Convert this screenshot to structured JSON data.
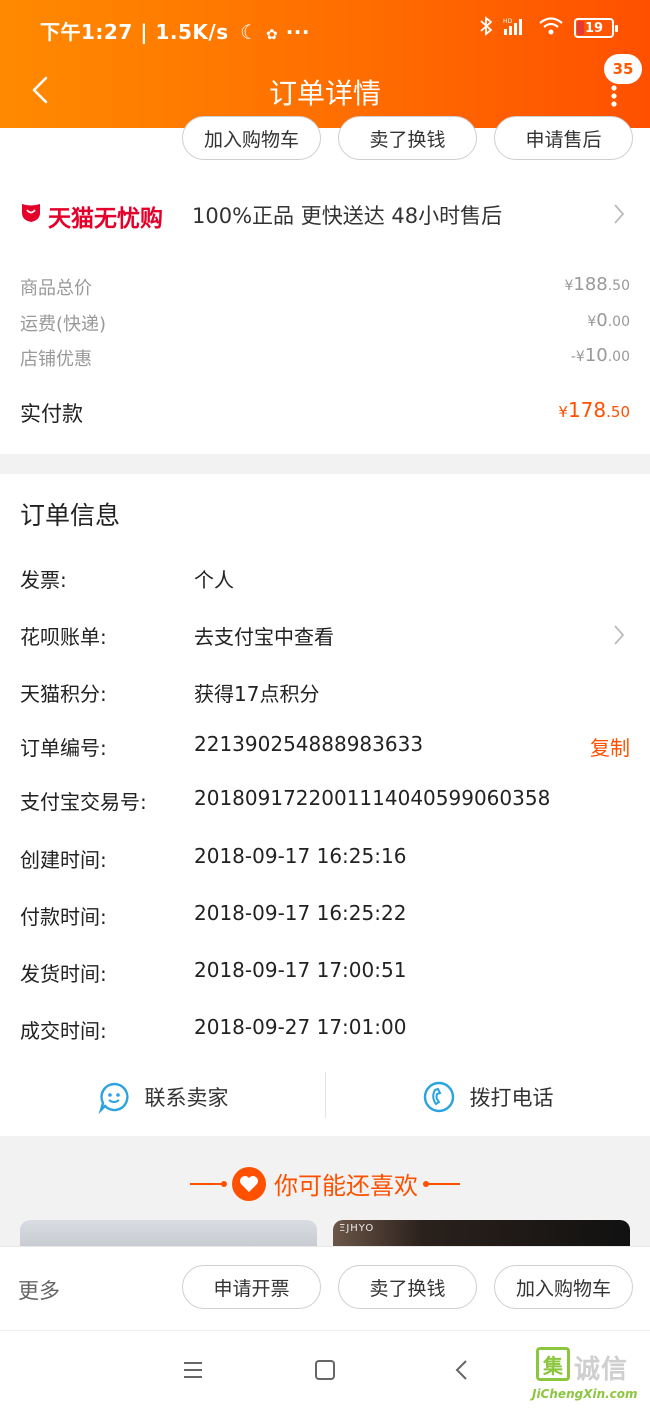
{
  "status_bar": {
    "time_speed": "下午1:27 | 1.5K/s",
    "battery": "19",
    "battery_fill": 0.19
  },
  "nav": {
    "title": "订单详情",
    "badge_count": "35"
  },
  "top_actions": {
    "add_cart": "加入购物车",
    "sell": "卖了换钱",
    "after_sale": "申请售后"
  },
  "tmall": {
    "brand": "天猫无忧购",
    "promise": "100%正品  更快送达  48小时售后"
  },
  "prices": {
    "goods_total": {
      "label": "商品总价",
      "symbol": "¥",
      "int": "188",
      "dec": ".50"
    },
    "shipping": {
      "label": "运费(快递)",
      "symbol": "¥",
      "int": "0",
      "dec": ".00"
    },
    "discount": {
      "label": "店铺优惠",
      "symbol": "-¥",
      "int": "10",
      "dec": ".00"
    },
    "paid": {
      "label": "实付款",
      "symbol": "¥",
      "int": "178",
      "dec": ".50"
    }
  },
  "order_info": {
    "title": "订单信息",
    "invoice": {
      "k": "发票:",
      "v": "个人"
    },
    "huabei": {
      "k": "花呗账单:",
      "v": "去支付宝中查看"
    },
    "points": {
      "k": "天猫积分:",
      "v": "获得17点积分"
    },
    "order_no": {
      "k": "订单编号:",
      "v": "221390254888983633",
      "copy": "复制"
    },
    "alipay_no": {
      "k": "支付宝交易号:",
      "v": "2018091722001114040599060358"
    },
    "created": {
      "k": "创建时间:",
      "v": "2018-09-17 16:25:16"
    },
    "paid_time": {
      "k": "付款时间:",
      "v": "2018-09-17 16:25:22"
    },
    "shipped": {
      "k": "发货时间:",
      "v": "2018-09-17 17:00:51"
    },
    "closed": {
      "k": "成交时间:",
      "v": "2018-09-27 17:01:00"
    }
  },
  "contact": {
    "seller": "联系卖家",
    "phone": "拨打电话"
  },
  "recommend": {
    "title": "你可能还喜欢",
    "thumb2_brand": "ΞJHYO"
  },
  "bottom_bar": {
    "more": "更多",
    "invoice": "申请开票",
    "sell": "卖了换钱",
    "add_cart": "加入购物车"
  },
  "watermark": {
    "box": "集",
    "text": "诚信",
    "url": "JiChengXin.com"
  }
}
